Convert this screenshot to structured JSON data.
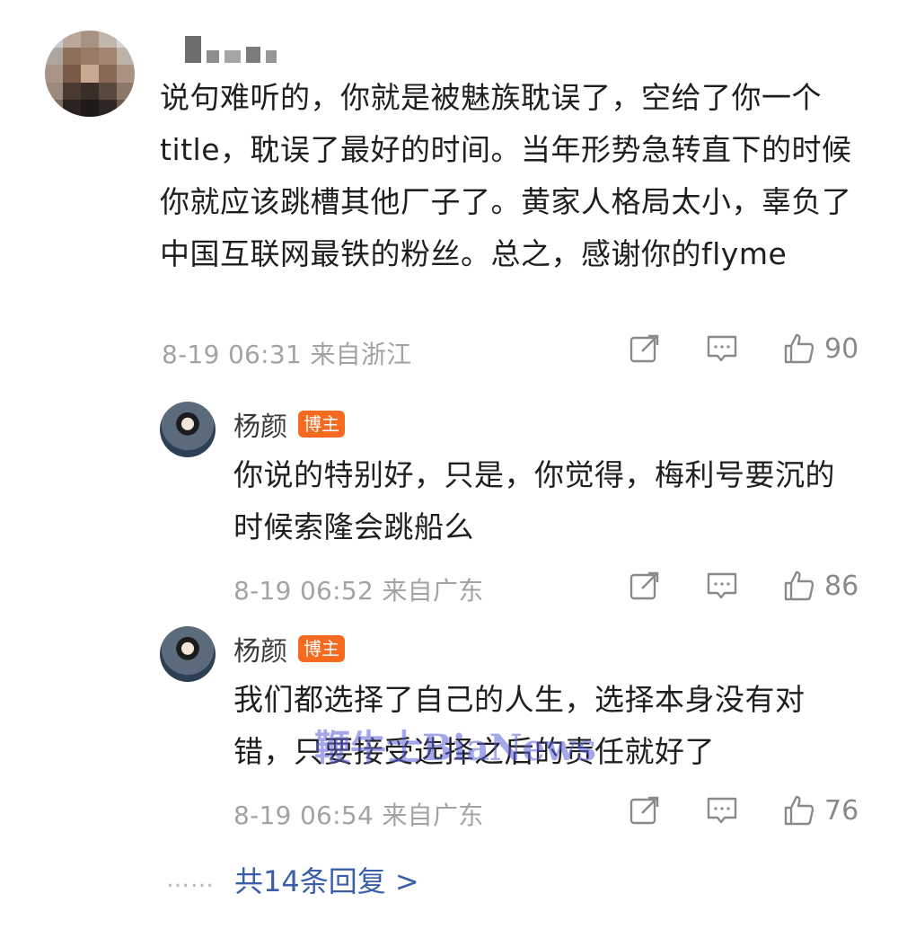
{
  "main_comment": {
    "text": "说句难听的，你就是被魅族耽误了，空给了你一个title，耽误了最好的时间。当年形势急转直下的时候你就应该跳槽其他厂子了。黄家人格局太小，辜负了中国互联网最铁的粉丝。总之，感谢你的flyme",
    "time": "8-19 06:31 来自浙江",
    "likes": "90"
  },
  "replies": [
    {
      "name": "杨颜",
      "badge": "博主",
      "text": "你说的特别好，只是，你觉得，梅利号要沉的时候索隆会跳船么",
      "time": "8-19 06:52 来自广东",
      "likes": "86"
    },
    {
      "name": "杨颜",
      "badge": "博主",
      "text": "我们都选择了自己的人生，选择本身没有对错，只要接受选择之后的责任就好了",
      "time": "8-19 06:54 来自广东",
      "likes": "76"
    }
  ],
  "more_replies": {
    "dots": "……",
    "label": "共14条回复 >"
  },
  "watermark": "鞭牛士BiaNews",
  "icons": {
    "forward": "forward-icon",
    "comment": "comment-icon",
    "like": "thumbs-up-icon"
  }
}
